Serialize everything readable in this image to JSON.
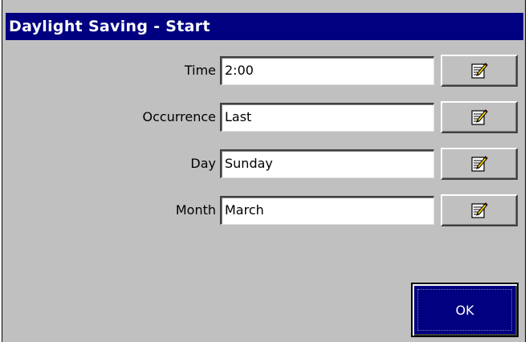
{
  "window": {
    "title": "Daylight Saving - Start"
  },
  "fields": [
    {
      "label": "Time",
      "value": "2:00",
      "edit_icon": "notepad-pencil-icon"
    },
    {
      "label": "Occurrence",
      "value": "Last",
      "edit_icon": "notepad-pencil-icon"
    },
    {
      "label": "Day",
      "value": "Sunday",
      "edit_icon": "notepad-pencil-icon"
    },
    {
      "label": "Month",
      "value": "March",
      "edit_icon": "notepad-pencil-icon"
    }
  ],
  "buttons": {
    "ok_label": "OK"
  },
  "colors": {
    "titlebar": "#000080",
    "dialog_bg": "#c0c0c0",
    "ok_bg": "#000080"
  }
}
